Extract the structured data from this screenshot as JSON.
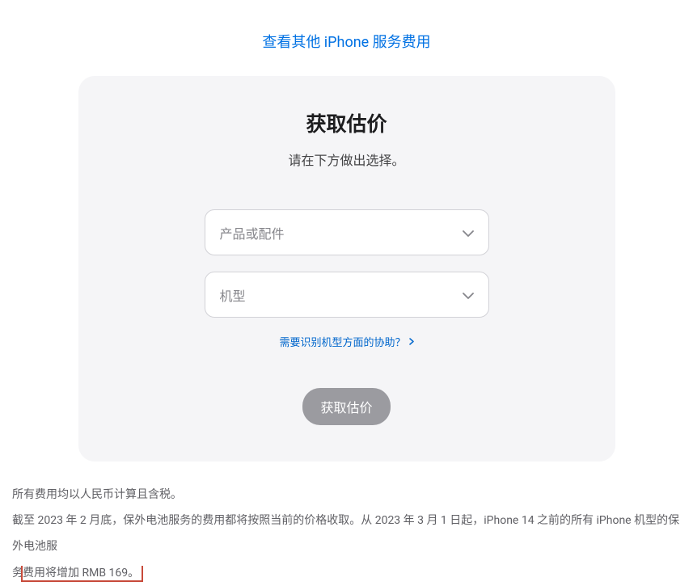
{
  "topLink": {
    "label": "查看其他 iPhone 服务费用"
  },
  "card": {
    "title": "获取估价",
    "subtitle": "请在下方做出选择。",
    "select1": {
      "placeholder": "产品或配件"
    },
    "select2": {
      "placeholder": "机型"
    },
    "helpLink": {
      "label": "需要识别机型方面的协助？"
    },
    "ctaButton": {
      "label": "获取估价"
    }
  },
  "footer": {
    "line1": "所有费用均以人民币计算且含税。",
    "line2_part1": "截至 2023 年 2 月底，保外电池服务的费用都将按照当前的价格收取。从 2023 年 3 月 1 日起，iPhone 14 之前的所有 iPhone 机型的保外电池服",
    "line2_part2": "务",
    "line2_highlight": "费用将增加 RMB 169。"
  }
}
